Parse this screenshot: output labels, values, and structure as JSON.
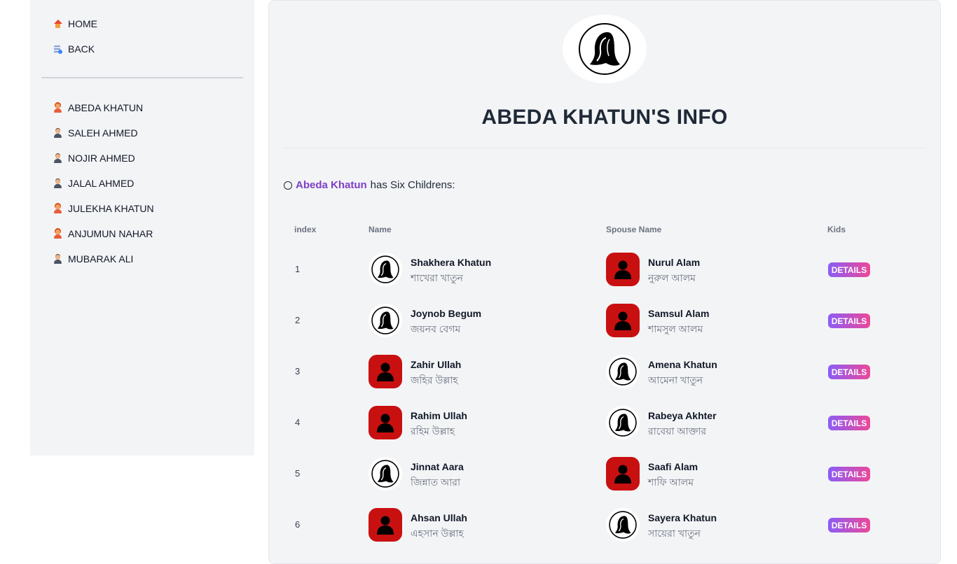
{
  "sidebar": {
    "nav": [
      {
        "label": "HOME",
        "icon": "home-icon"
      },
      {
        "label": "BACK",
        "icon": "back-icon"
      }
    ],
    "people": [
      {
        "label": "ABEDA KHATUN",
        "gender": "female"
      },
      {
        "label": "SALEH AHMED",
        "gender": "male"
      },
      {
        "label": "NOJIR AHMED",
        "gender": "male"
      },
      {
        "label": "JALAL AHMED",
        "gender": "male"
      },
      {
        "label": "JULEKHA KHATUN",
        "gender": "female"
      },
      {
        "label": "ANJUMUN NAHAR",
        "gender": "female"
      },
      {
        "label": "MUBARAK ALI",
        "gender": "male"
      }
    ]
  },
  "main": {
    "title": "ABEDA KHATUN'S INFO",
    "intro": {
      "name": "Abeda Khatun",
      "text": "has Six Childrens:"
    },
    "table": {
      "headers": {
        "index": "index",
        "name": "Name",
        "spouse": "Spouse Name",
        "kids": "Kids"
      },
      "details_label": "DETAILS",
      "rows": [
        {
          "index": "1",
          "name": "Shakhera Khatun",
          "name_bn": "শাখেরা খাতুন",
          "gender": "female",
          "spouse": "Nurul Alam",
          "spouse_bn": "নুরুল আলম",
          "spouse_gender": "male"
        },
        {
          "index": "2",
          "name": "Joynob Begum",
          "name_bn": "জয়নব বেগম",
          "gender": "female",
          "spouse": "Samsul Alam",
          "spouse_bn": "শামসুল আলম",
          "spouse_gender": "male"
        },
        {
          "index": "3",
          "name": "Zahir Ullah",
          "name_bn": "জহির উল্লাহ",
          "gender": "male",
          "spouse": "Amena Khatun",
          "spouse_bn": "আমেনা খাতুন",
          "spouse_gender": "female"
        },
        {
          "index": "4",
          "name": "Rahim Ullah",
          "name_bn": "রহিম উল্লাহ",
          "gender": "male",
          "spouse": "Rabeya Akhter",
          "spouse_bn": "রাবেয়া আক্তার",
          "spouse_gender": "female"
        },
        {
          "index": "5",
          "name": "Jinnat Aara",
          "name_bn": "জিন্নাত আরা",
          "gender": "female",
          "spouse": "Saafi Alam",
          "spouse_bn": "শাফি আলম",
          "spouse_gender": "male"
        },
        {
          "index": "6",
          "name": "Ahsan Ullah",
          "name_bn": "এহসান উল্লাহ",
          "gender": "male",
          "spouse": "Sayera Khatun",
          "spouse_bn": "সায়েরা খাতুন",
          "spouse_gender": "female"
        }
      ]
    }
  },
  "colors": {
    "accent_name": "#7e3fc9",
    "male_avatar_bg": "#c81010",
    "details_gradient_start": "#8b5cf6",
    "details_gradient_end": "#ec4899"
  }
}
